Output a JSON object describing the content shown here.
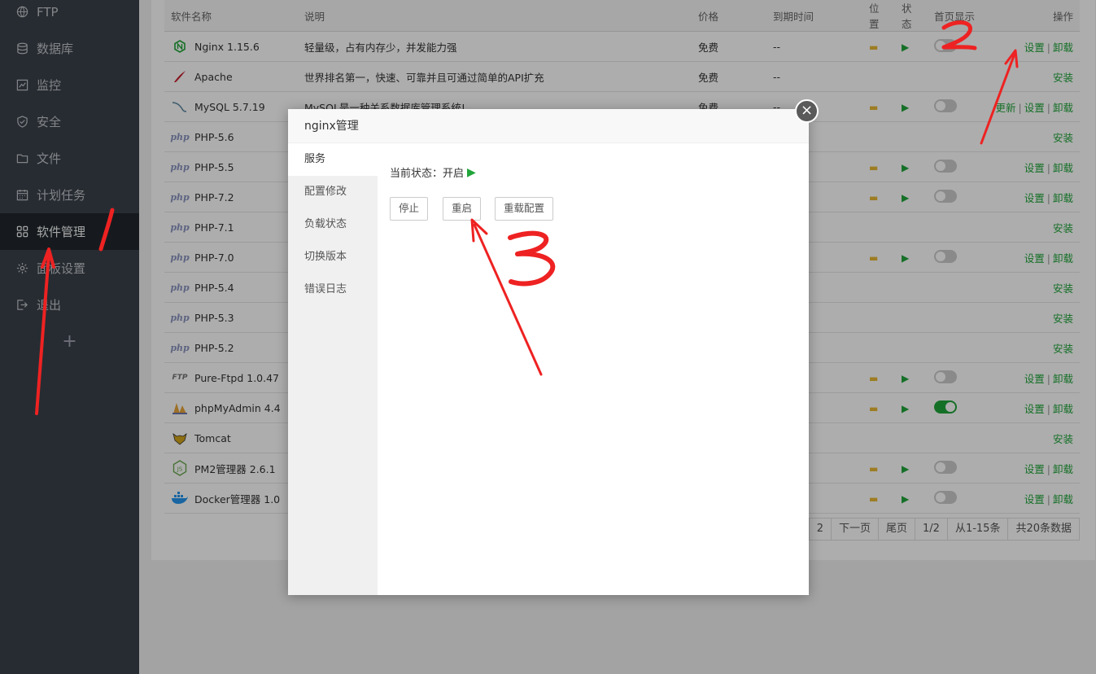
{
  "sidebar": {
    "items": [
      {
        "label": "FTP",
        "icon": "globe-icon"
      },
      {
        "label": "数据库",
        "icon": "database-icon"
      },
      {
        "label": "监控",
        "icon": "chart-icon"
      },
      {
        "label": "安全",
        "icon": "shield-icon"
      },
      {
        "label": "文件",
        "icon": "folder-icon"
      },
      {
        "label": "计划任务",
        "icon": "calendar-icon"
      },
      {
        "label": "软件管理",
        "icon": "grid-icon",
        "active": true
      },
      {
        "label": "面板设置",
        "icon": "gear-icon"
      },
      {
        "label": "退出",
        "icon": "logout-icon"
      }
    ],
    "add_label": "+"
  },
  "table": {
    "headers": {
      "name": "软件名称",
      "desc": "说明",
      "price": "价格",
      "expire": "到期时间",
      "location": "位置",
      "status": "状态",
      "home": "首页显示",
      "op": "操作"
    },
    "rows": [
      {
        "name": "Nginx 1.15.6",
        "desc": "轻量级，占有内存少，并发能力强",
        "price": "免费",
        "expire": "--",
        "op": "设置|卸载",
        "logo": "nginx-logo"
      },
      {
        "name": "Apache",
        "desc": "世界排名第一，快速、可靠并且可通过简单的API扩充",
        "price": "免费",
        "expire": "--",
        "op": "安装",
        "logo": "apache-logo"
      },
      {
        "name": "MySQL 5.7.19",
        "desc": "MySQL是一种关系数据库管理系统!",
        "price": "免费",
        "expire": "--",
        "op": "更新|设置|卸载",
        "logo": "mysql-logo"
      },
      {
        "name": "PHP-5.6",
        "op": "安装",
        "logo": "php"
      },
      {
        "name": "PHP-5.5",
        "op": "设置|卸载",
        "logo": "php"
      },
      {
        "name": "PHP-7.2",
        "op": "设置|卸载",
        "logo": "php"
      },
      {
        "name": "PHP-7.1",
        "op": "安装",
        "logo": "php"
      },
      {
        "name": "PHP-7.0",
        "op": "设置|卸载",
        "logo": "php"
      },
      {
        "name": "PHP-5.4",
        "op": "安装",
        "logo": "php"
      },
      {
        "name": "PHP-5.3",
        "op": "安装",
        "logo": "php"
      },
      {
        "name": "PHP-5.2",
        "op": "安装",
        "logo": "php"
      },
      {
        "name": "Pure-Ftpd 1.0.47",
        "op": "设置|卸载",
        "logo": "ftp"
      },
      {
        "name": "phpMyAdmin 4.4",
        "op": "设置|卸载",
        "logo": "pma-logo"
      },
      {
        "name": "Tomcat",
        "op": "安装",
        "logo": "tomcat-logo"
      },
      {
        "name": "PM2管理器 2.6.1",
        "op": "设置|卸载",
        "logo": "node-logo"
      },
      {
        "name": "Docker管理器 1.0",
        "op": "设置|卸载",
        "logo": "docker-logo"
      }
    ],
    "php_text": "php",
    "ftp_text": "FTP"
  },
  "pager": [
    "2",
    "下一页",
    "尾页",
    "1/2",
    "从1-15条",
    "共20条数据"
  ],
  "modal": {
    "title": "nginx管理",
    "tabs": [
      "服务",
      "配置修改",
      "负载状态",
      "切换版本",
      "错误日志"
    ],
    "status_label": "当前状态：开启",
    "buttons": {
      "stop": "停止",
      "restart": "重启",
      "reload": "重载配置"
    },
    "close": "×"
  },
  "colors": {
    "accent": "#20a53a",
    "annotation": "#ee2222"
  }
}
